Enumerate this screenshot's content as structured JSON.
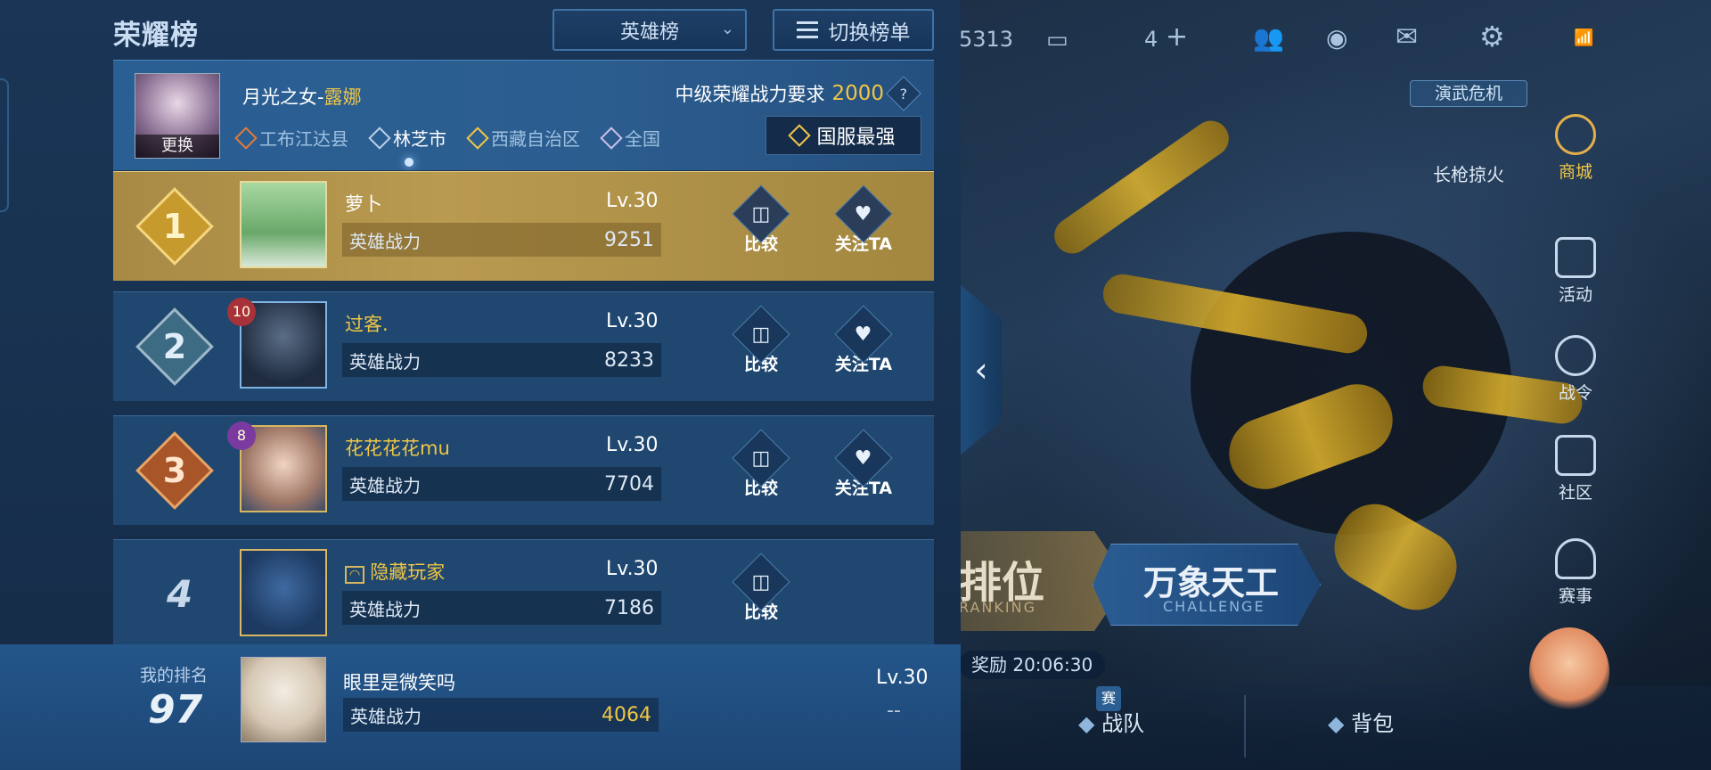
{
  "panel": {
    "title": "荣耀榜",
    "dropdown_value": "英雄榜",
    "switch_label": "切换榜单"
  },
  "hero": {
    "name_prefix": "月光之女-",
    "name_hero": "露娜",
    "change_label": "更换",
    "requirement_label": "中级荣耀战力要求",
    "requirement_value": "2000",
    "help_glyph": "?",
    "regions": [
      "工布江达县",
      "林芝市",
      "西藏自治区",
      "全国"
    ],
    "active_region_index": 1,
    "strongest_label": "国服最强"
  },
  "rows": [
    {
      "rank": "1",
      "name": "萝卜",
      "level": "Lv.30",
      "power_label": "英雄战力",
      "power": "9251",
      "compare": "比较",
      "follow": "关注TA",
      "name_color": "white"
    },
    {
      "rank": "2",
      "name": "过客.",
      "level": "Lv.30",
      "power_label": "英雄战力",
      "power": "8233",
      "compare": "比较",
      "follow": "关注TA",
      "avatar_badge": "10",
      "name_color": "yellow"
    },
    {
      "rank": "3",
      "name": "花花花花mu",
      "level": "Lv.30",
      "power_label": "英雄战力",
      "power": "7704",
      "compare": "比较",
      "follow": "关注TA",
      "avatar_badge": "8",
      "name_color": "yellow"
    },
    {
      "rank": "4",
      "name": "隐藏玩家",
      "level": "Lv.30",
      "power_label": "英雄战力",
      "power": "7186",
      "compare": "比较",
      "name_color": "yellow"
    }
  ],
  "my_rank": {
    "label": "我的排名",
    "rank": "97",
    "name": "眼里是微笑吗",
    "level": "Lv.30",
    "power_label": "英雄战力",
    "power": "4064",
    "extra": "--"
  },
  "lobby": {
    "currency_partial": "5313",
    "add_count": "4",
    "event_tag": "演武危机",
    "event_name": "长枪掠火",
    "right_menu": [
      "商城",
      "活动",
      "战令",
      "社区",
      "赛事"
    ],
    "rank_title": "排位",
    "rank_sub": "RANKING",
    "challenge_title": "万象天工",
    "challenge_sub": "CHALLENGE",
    "reward_prefix": "奖励",
    "reward_timer": "20:06:30",
    "bottom_tabs": [
      "战队",
      "背包"
    ],
    "sai_badge": "赛",
    "collapse_glyph": "‹"
  },
  "colors": {
    "accent_gold": "#f0c645",
    "panel_bg": "#17304e",
    "gold_row": "#b99a50",
    "rank2": "#9fb8c8",
    "rank3": "#c8763a"
  }
}
